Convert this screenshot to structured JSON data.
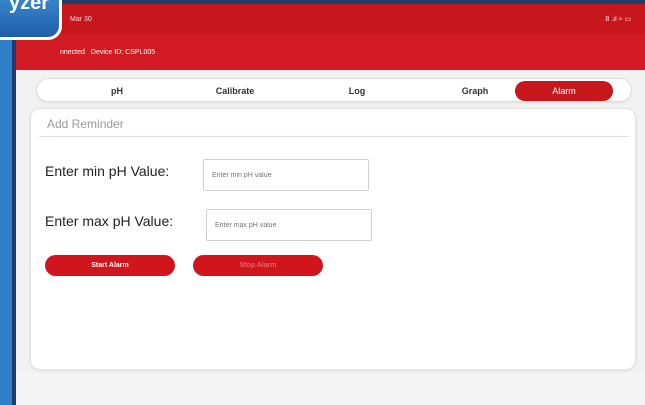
{
  "badge": {
    "text": "yzer"
  },
  "statusbar": {
    "time": "Mar 30",
    "icons": "8 .ıl ≈ ▭"
  },
  "appbar": {
    "status": "nnected",
    "device": "Device ID: CSPL005"
  },
  "tabs": [
    {
      "label": "pH",
      "active": false
    },
    {
      "label": "Calibrate",
      "active": false
    },
    {
      "label": "Log",
      "active": false
    },
    {
      "label": "Graph",
      "active": false
    },
    {
      "label": "Alarm",
      "active": true
    }
  ],
  "card": {
    "title": "Add Reminder",
    "min_label": "Enter min pH Value:",
    "min_placeholder": "Enter min pH value",
    "max_label": "Enter max pH Value:",
    "max_placeholder": "Enter max pH value",
    "start_button": "Start Alarm",
    "stop_button": "Stop Alarm"
  },
  "colors": {
    "primary": "#c8161d",
    "badge": "#2f7fc7"
  }
}
